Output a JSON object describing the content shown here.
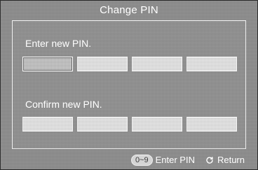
{
  "window": {
    "title": "Change PIN"
  },
  "form": {
    "enter_label": "Enter new PIN.",
    "confirm_label": "Confirm new PIN.",
    "enter_pin_fields": [
      "",
      "",
      "",
      ""
    ],
    "confirm_pin_fields": [
      "",
      "",
      "",
      ""
    ]
  },
  "footer": {
    "digits_key": "0~9",
    "enter_pin_label": "Enter PIN",
    "return_label": "Return"
  },
  "icons": {
    "return": "return-icon"
  }
}
